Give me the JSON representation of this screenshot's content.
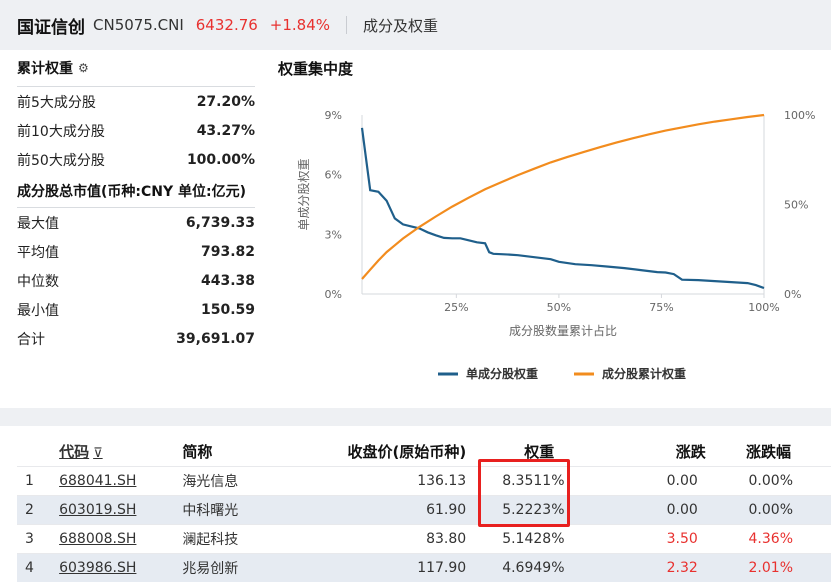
{
  "header": {
    "name": "国证信创",
    "code": "CN5075.CNI",
    "price": "6432.76",
    "change": "+1.84%",
    "subtitle": "成分及权重"
  },
  "cumulative": {
    "title": "累计权重",
    "icon": "settings-icon",
    "rows": [
      {
        "label": "前5大成分股",
        "value": "27.20%"
      },
      {
        "label": "前10大成分股",
        "value": "43.27%"
      },
      {
        "label": "前50大成分股",
        "value": "100.00%"
      }
    ]
  },
  "market_cap": {
    "title": "成分股总市值(币种:CNY 单位:亿元)",
    "rows": [
      {
        "label": "最大值",
        "value": "6,739.33"
      },
      {
        "label": "平均值",
        "value": "793.82"
      },
      {
        "label": "中位数",
        "value": "443.38"
      },
      {
        "label": "最小值",
        "value": "150.59"
      },
      {
        "label": "合计",
        "value": "39,691.07"
      }
    ]
  },
  "chart_title": "权重集中度",
  "chart_data": {
    "type": "line",
    "xlabel": "成分股数量累计占比",
    "ylabel_left": "单成分股权重",
    "x_ticks": [
      "25%",
      "50%",
      "75%",
      "100%"
    ],
    "y_left_ticks": [
      "0%",
      "3%",
      "6%",
      "9%"
    ],
    "y_right_ticks": [
      "0%",
      "50%",
      "100%"
    ],
    "y_left_range": [
      0,
      9
    ],
    "y_right_range": [
      0,
      100
    ],
    "x_range": [
      2,
      100
    ],
    "legend_position": "bottom",
    "colors": {
      "single": "#1f5f8b",
      "cumulative": "#f28c1e"
    },
    "series": [
      {
        "name": "单成分股权重",
        "axis": "left",
        "x": [
          2,
          4,
          6,
          8,
          10,
          12,
          14,
          16,
          18,
          20,
          22,
          24,
          26,
          28,
          30,
          32,
          33,
          34,
          36,
          38,
          40,
          44,
          48,
          50,
          54,
          58,
          62,
          66,
          70,
          72,
          74,
          76,
          78,
          80,
          84,
          88,
          92,
          96,
          98,
          100
        ],
        "y": [
          8.35,
          5.22,
          5.14,
          4.69,
          3.8,
          3.5,
          3.4,
          3.3,
          3.1,
          2.95,
          2.82,
          2.8,
          2.8,
          2.7,
          2.6,
          2.55,
          2.1,
          2.02,
          2.0,
          1.98,
          1.95,
          1.85,
          1.75,
          1.62,
          1.5,
          1.45,
          1.38,
          1.3,
          1.2,
          1.15,
          1.1,
          1.08,
          1.0,
          0.72,
          0.7,
          0.65,
          0.6,
          0.55,
          0.45,
          0.3
        ]
      },
      {
        "name": "成分股累计权重",
        "axis": "right",
        "x": [
          2,
          4,
          6,
          8,
          10,
          12,
          16,
          20,
          24,
          28,
          32,
          36,
          40,
          44,
          48,
          52,
          56,
          60,
          64,
          68,
          72,
          76,
          80,
          84,
          88,
          92,
          96,
          100
        ],
        "y": [
          8.4,
          13.6,
          18.7,
          23.4,
          27.2,
          31.0,
          37.5,
          43.3,
          48.8,
          53.8,
          58.5,
          62.5,
          66.4,
          70.0,
          73.5,
          76.5,
          79.3,
          82.0,
          84.6,
          87.0,
          89.2,
          91.3,
          93.1,
          94.8,
          96.3,
          97.6,
          98.9,
          100.0
        ]
      }
    ]
  },
  "table": {
    "headers": [
      "代码",
      "简称",
      "收盘价(原始币种)",
      "权重",
      "涨跌",
      "涨跌幅"
    ],
    "filter_icon": "filter-icon",
    "rows": [
      {
        "idx": "1",
        "code": "688041.SH",
        "name": "海光信息",
        "price": "136.13",
        "weight": "8.3511%",
        "chg": "0.00",
        "pct": "0.00%",
        "up": false
      },
      {
        "idx": "2",
        "code": "603019.SH",
        "name": "中科曙光",
        "price": "61.90",
        "weight": "5.2223%",
        "chg": "0.00",
        "pct": "0.00%",
        "up": false
      },
      {
        "idx": "3",
        "code": "688008.SH",
        "name": "澜起科技",
        "price": "83.80",
        "weight": "5.1428%",
        "chg": "3.50",
        "pct": "4.36%",
        "up": true
      },
      {
        "idx": "4",
        "code": "603986.SH",
        "name": "兆易创新",
        "price": "117.90",
        "weight": "4.6949%",
        "chg": "2.32",
        "pct": "2.01%",
        "up": true
      }
    ]
  }
}
